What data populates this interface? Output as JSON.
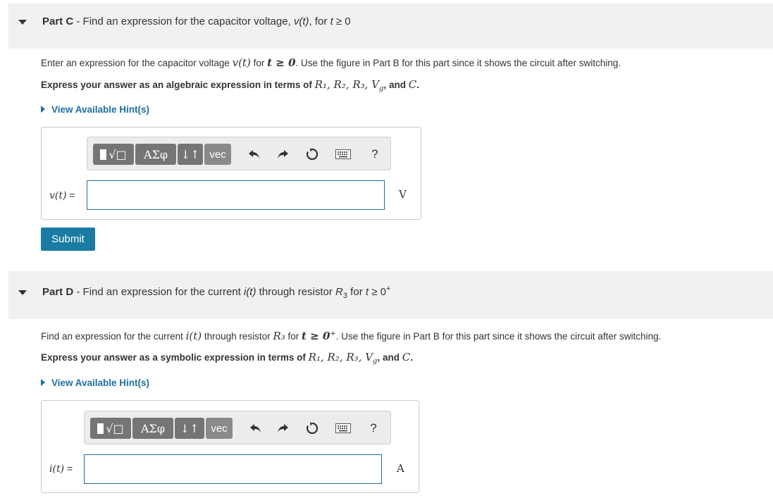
{
  "part_c": {
    "title_bold": "Part C",
    "title_sep": " - ",
    "title_text_pre": "Find an expression for the capacitor voltage, ",
    "title_var": "v(t)",
    "title_text_post": ", for ",
    "title_cond": "t",
    "title_cond_rest": " ≥ 0",
    "intro_pre": "Enter an expression for the capacitor voltage ",
    "intro_var": "v(t)",
    "intro_mid": " for ",
    "intro_cond": "t ≥ 0",
    "intro_post": ". Use the figure in Part B for this part since it shows the circuit after switching.",
    "express_pre": "Express your answer as an algebraic expression in terms of ",
    "express_vars": "R₁, R₂, R₃, V",
    "express_sub": "g",
    "express_and": ", and ",
    "express_c": "C",
    "express_end": ".",
    "hint_label": "View Available Hint(s)",
    "answer_label": "v(t)",
    "answer_eq": " =",
    "answer_value": "",
    "unit": "V",
    "submit_label": "Submit"
  },
  "part_d": {
    "title_bold": "Part D",
    "title_sep": " - ",
    "title_text_pre": "Find an expression for the current ",
    "title_var": "i(t)",
    "title_text_post": " through resistor ",
    "title_r": "R",
    "title_r_sub": "3",
    "title_for": " for ",
    "title_cond": "t",
    "title_cond_rest": " ≥ 0",
    "title_cond_sup": "+",
    "intro_pre": "Find an expression for the current ",
    "intro_var": "i(t)",
    "intro_mid": " through resistor ",
    "intro_r": "R₃",
    "intro_for": " for ",
    "intro_cond": "t ≥ 0",
    "intro_sup": "+",
    "intro_post": ".   Use the figure in Part B for this part since it shows the circuit after switching.",
    "express_pre": "Express your answer as a symbolic expression in terms of ",
    "express_vars": "R₁, R₂, R₃, V",
    "express_sub": "g",
    "express_and": ", and ",
    "express_c": "C",
    "express_end": ".",
    "hint_label": "View Available Hint(s)",
    "answer_label": "i(t)",
    "answer_eq": " =",
    "answer_value": "",
    "unit": "A"
  },
  "toolbar": {
    "templates_label": "√□",
    "greek_label": "ΑΣφ",
    "arrows_label": "↓↑",
    "vec_label": "vec",
    "help_label": "?",
    "icons": [
      "templates-icon",
      "greek-icon",
      "sub-sup-icon",
      "vector-icon",
      "undo-icon",
      "redo-icon",
      "reset-icon",
      "keyboard-icon",
      "help-icon"
    ]
  }
}
